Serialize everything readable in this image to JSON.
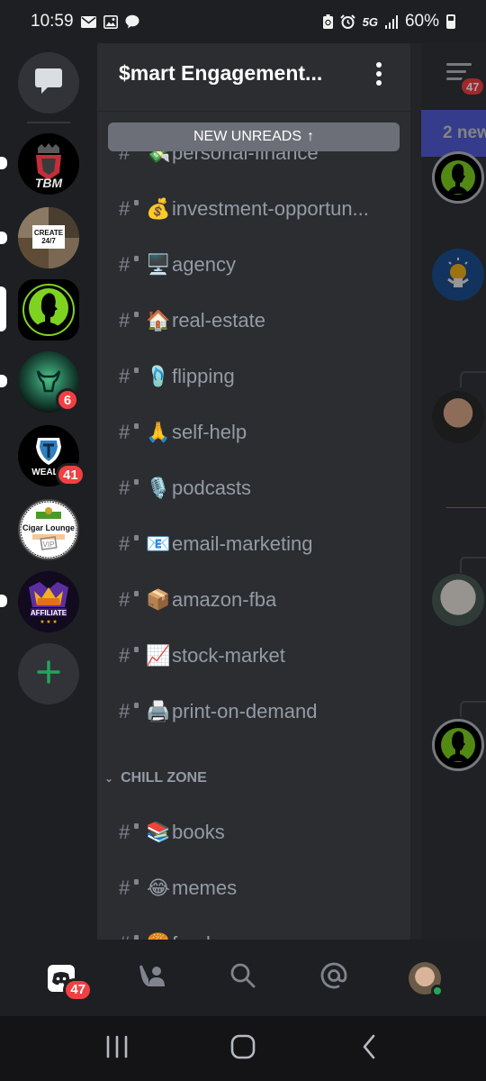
{
  "status_bar": {
    "time": "10:59",
    "left_icons": [
      "mail-icon",
      "image-icon",
      "chat-bubble-icon"
    ],
    "right_icons": [
      "battery-saver-icon",
      "alarm-icon",
      "5g-icon",
      "signal-icon"
    ],
    "network": "5G",
    "battery": "60%"
  },
  "server_rail": {
    "dm_button": "direct-messages",
    "servers": [
      {
        "name": "TBM",
        "label": "TBM",
        "unread": true,
        "badge": null,
        "selected": false,
        "bg": "#000000",
        "accent": "#c62d3a"
      },
      {
        "name": "CREATE 24/7",
        "label": "CREATE 24/7",
        "unread": true,
        "badge": null,
        "selected": false,
        "bg": "#6a5a48",
        "accent": "#ffffff"
      },
      {
        "name": "$mart Engagement",
        "label": "",
        "unread": false,
        "badge": null,
        "selected": true,
        "bg": "#000000",
        "accent": "#7ed321"
      },
      {
        "name": "Bull Server",
        "label": "",
        "unread": true,
        "badge": "6",
        "selected": false,
        "bg": "#0e2a22",
        "accent": "#4cc28a"
      },
      {
        "name": "Wealth Squad",
        "label": "WEAL",
        "unread": false,
        "badge": "41",
        "selected": false,
        "bg": "#000000",
        "accent": "#2f7fc1"
      },
      {
        "name": "Cigar Lounge VIP",
        "label": "Cigar Lounge",
        "unread": false,
        "badge": null,
        "selected": false,
        "bg": "#ffffff",
        "accent": "#222222"
      },
      {
        "name": "Affiliate Grandmasters",
        "label": "AFFILIATE",
        "unread": true,
        "badge": null,
        "selected": false,
        "bg": "#120a1e",
        "accent": "#f2b01e"
      }
    ],
    "add_server_label": "+"
  },
  "channel_panel": {
    "server_name": "$mart Engagement...",
    "new_unreads_label": "NEW UNREADS",
    "new_unreads_arrow": "↑",
    "channels": [
      {
        "emoji": "💸",
        "name": "personal-finance",
        "locked": true
      },
      {
        "emoji": "💰",
        "name": "investment-opportun...",
        "locked": true
      },
      {
        "emoji": "🖥️",
        "name": "agency",
        "locked": true
      },
      {
        "emoji": "🏠",
        "name": "real-estate",
        "locked": true
      },
      {
        "emoji": "🩴",
        "name": "flipping",
        "locked": true
      },
      {
        "emoji": "🙏",
        "name": "self-help",
        "locked": true
      },
      {
        "emoji": "🎙️",
        "name": "podcasts",
        "locked": true
      },
      {
        "emoji": "📧",
        "name": "email-marketing",
        "locked": true
      },
      {
        "emoji": "📦",
        "name": "amazon-fba",
        "locked": true
      },
      {
        "emoji": "📈",
        "name": "stock-market",
        "locked": true
      },
      {
        "emoji": "🖨️",
        "name": "print-on-demand",
        "locked": true
      }
    ],
    "category": {
      "name": "CHILL ZONE",
      "collapsed": false
    },
    "category_channels": [
      {
        "emoji": "📚",
        "name": "books",
        "locked": true
      },
      {
        "emoji": "😂",
        "name": "memes",
        "locked": true
      },
      {
        "emoji": "🍔",
        "name": "food",
        "locked": true
      }
    ]
  },
  "chat_preview": {
    "menu_badge": "47",
    "new_messages_bar": "2 new",
    "accent": "#5865f2"
  },
  "bottom_nav": {
    "items": [
      {
        "name": "home",
        "badge": "47"
      },
      {
        "name": "friends"
      },
      {
        "name": "search"
      },
      {
        "name": "mentions"
      },
      {
        "name": "profile",
        "status": "online"
      }
    ]
  },
  "android_nav": [
    "recent-apps",
    "home",
    "back"
  ],
  "colors": {
    "badge_red": "#f23f42",
    "add_server_green": "#23a55a",
    "blurple": "#5865f2"
  }
}
